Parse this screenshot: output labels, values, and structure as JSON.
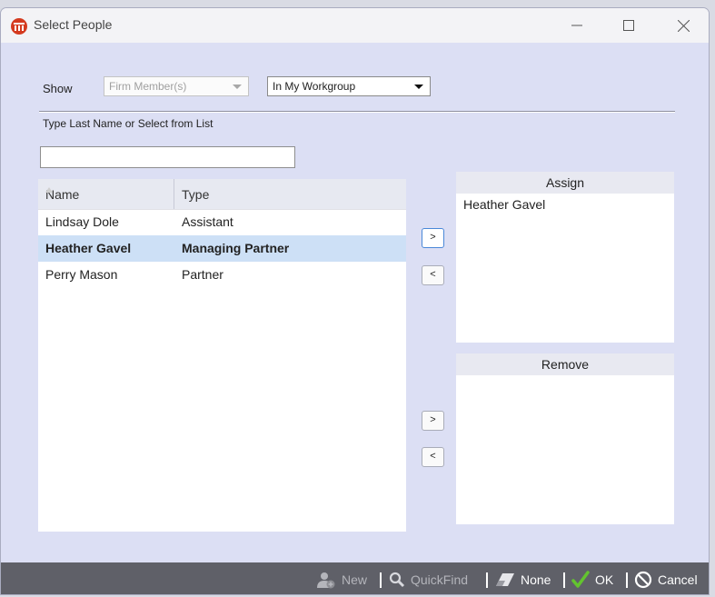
{
  "window": {
    "title": "Select People"
  },
  "filters": {
    "show_label": "Show",
    "member_select": "Firm Member(s)",
    "group_select": "In My Workgroup",
    "search_label": "Type Last Name or Select from List",
    "search_value": ""
  },
  "list": {
    "columns": [
      "Name",
      "Type"
    ],
    "rows": [
      {
        "name": "Lindsay Dole",
        "type": "Assistant"
      },
      {
        "name": "Heather Gavel",
        "type": "Managing Partner",
        "selected": true
      },
      {
        "name": "Perry Mason",
        "type": "Partner"
      }
    ]
  },
  "buttons": {
    "add": ">",
    "remove": "<"
  },
  "assign": {
    "header": "Assign",
    "items": [
      "Heather Gavel"
    ]
  },
  "remove": {
    "header": "Remove",
    "items": []
  },
  "footer": {
    "new": "New",
    "quickfind": "QuickFind",
    "none": "None",
    "ok": "OK",
    "cancel": "Cancel"
  },
  "colors": {
    "accent_check": "#63c32f",
    "selection": "#cde0f6",
    "footer_bg": "#5f6068",
    "app_icon": "#d43a1f"
  }
}
